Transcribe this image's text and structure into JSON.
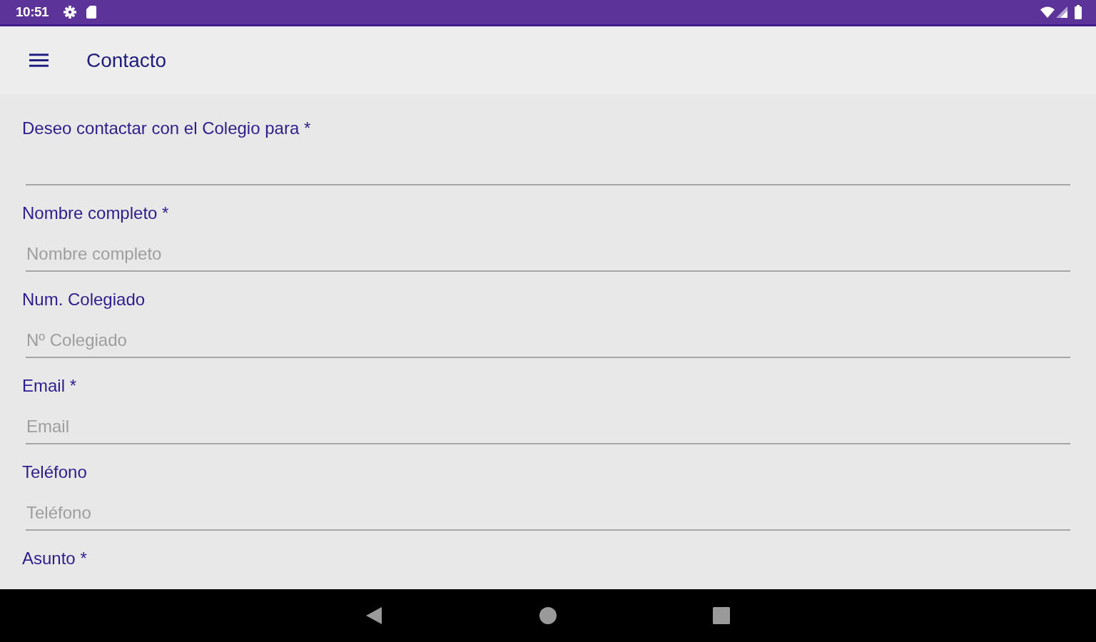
{
  "status_bar": {
    "time": "10:51"
  },
  "app_bar": {
    "title": "Contacto"
  },
  "form": {
    "fields": [
      {
        "label": "Deseo contactar con el Colegio para *",
        "kind": "select"
      },
      {
        "label": "Nombre completo *",
        "kind": "text",
        "placeholder": "Nombre completo"
      },
      {
        "label": "Num. Colegiado",
        "kind": "text",
        "placeholder": "Nº Colegiado"
      },
      {
        "label": "Email *",
        "kind": "text",
        "placeholder": "Email"
      },
      {
        "label": "Teléfono",
        "kind": "text",
        "placeholder": "Teléfono"
      },
      {
        "label": "Asunto *",
        "kind": "label"
      }
    ]
  }
}
